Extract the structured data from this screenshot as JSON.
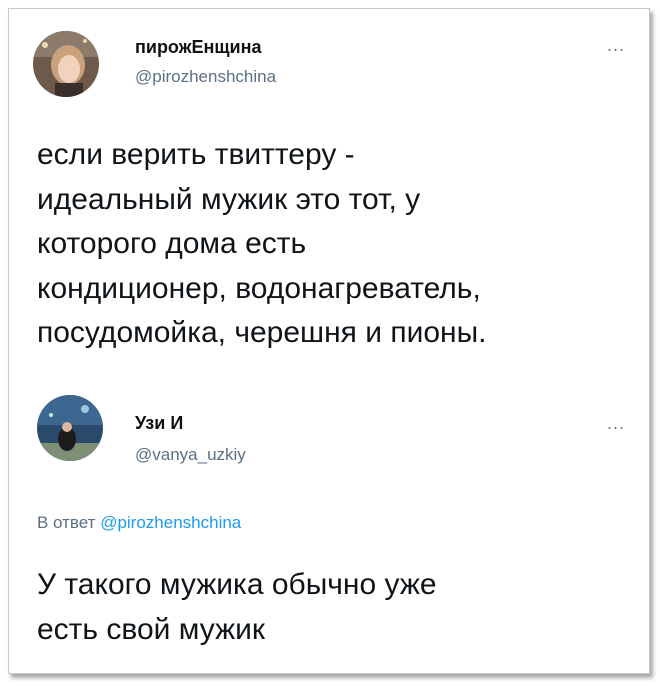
{
  "tweets": [
    {
      "display_name": "пирожЕнщина",
      "handle": "@pirozhenshchina",
      "more": "...",
      "text_lines": [
        "если верить твиттеру -",
        "идеальный мужик это тот, у",
        "которого дома есть",
        "кондиционер, водонагреватель,",
        "посудомойка, черешня и пионы."
      ]
    },
    {
      "display_name": "Узи И",
      "handle": "@vanya_uzkiy",
      "more": "...",
      "reply_prefix": "В ответ",
      "reply_handle": "@pirozhenshchina",
      "text_lines": [
        "У такого мужика обычно уже",
        "есть свой мужик"
      ]
    }
  ],
  "colors": {
    "text": "#0f1419",
    "secondary": "#5b7083",
    "link": "#1d9bf0"
  }
}
